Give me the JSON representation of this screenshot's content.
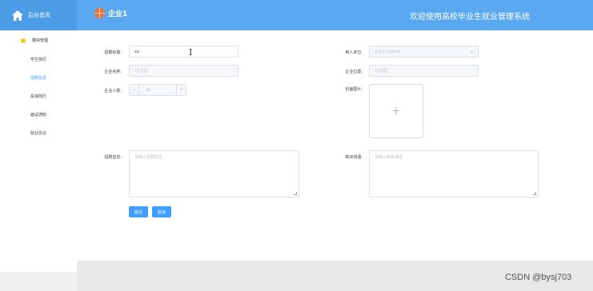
{
  "header": {
    "home_label": "后台首页",
    "company_name": "企业1",
    "system_title": "欢迎使用高校毕业生就业管理系统"
  },
  "sidebar": {
    "group_label": "模块管理",
    "items": [
      {
        "label": "学生简历",
        "active": false
      },
      {
        "label": "招聘信息",
        "active": true
      },
      {
        "label": "投递简历",
        "active": false
      },
      {
        "label": "面试通知",
        "active": false
      },
      {
        "label": "就业协议",
        "active": false
      }
    ]
  },
  "form": {
    "title_label": "招聘标题:",
    "title_value": "xx",
    "employer_label": "用人单位:",
    "employer_placeholder": "企业1-tfdgfds",
    "company_name_label": "企业名称:",
    "company_name_value": "XX企业",
    "company_location_label": "企业位置:",
    "company_location_value": "XX地区",
    "company_size_label": "企业人数:",
    "company_size_value": "30",
    "stepper_minus": "−",
    "stepper_plus": "+",
    "cover_label": "封面图片:",
    "upload_plus": "+",
    "recruit_info_label": "招聘信息:",
    "recruit_info_placeholder": "请输入招聘信息",
    "salary_label": "薪资待遇:",
    "salary_placeholder": "请输入薪资待遇"
  },
  "actions": {
    "submit_label": "提交",
    "cancel_label": "取消"
  },
  "watermark": "CSDN @bysj703",
  "colors": {
    "header_bg": "#5aa8f0",
    "primary": "#409eff",
    "dot": "#f5c518"
  }
}
